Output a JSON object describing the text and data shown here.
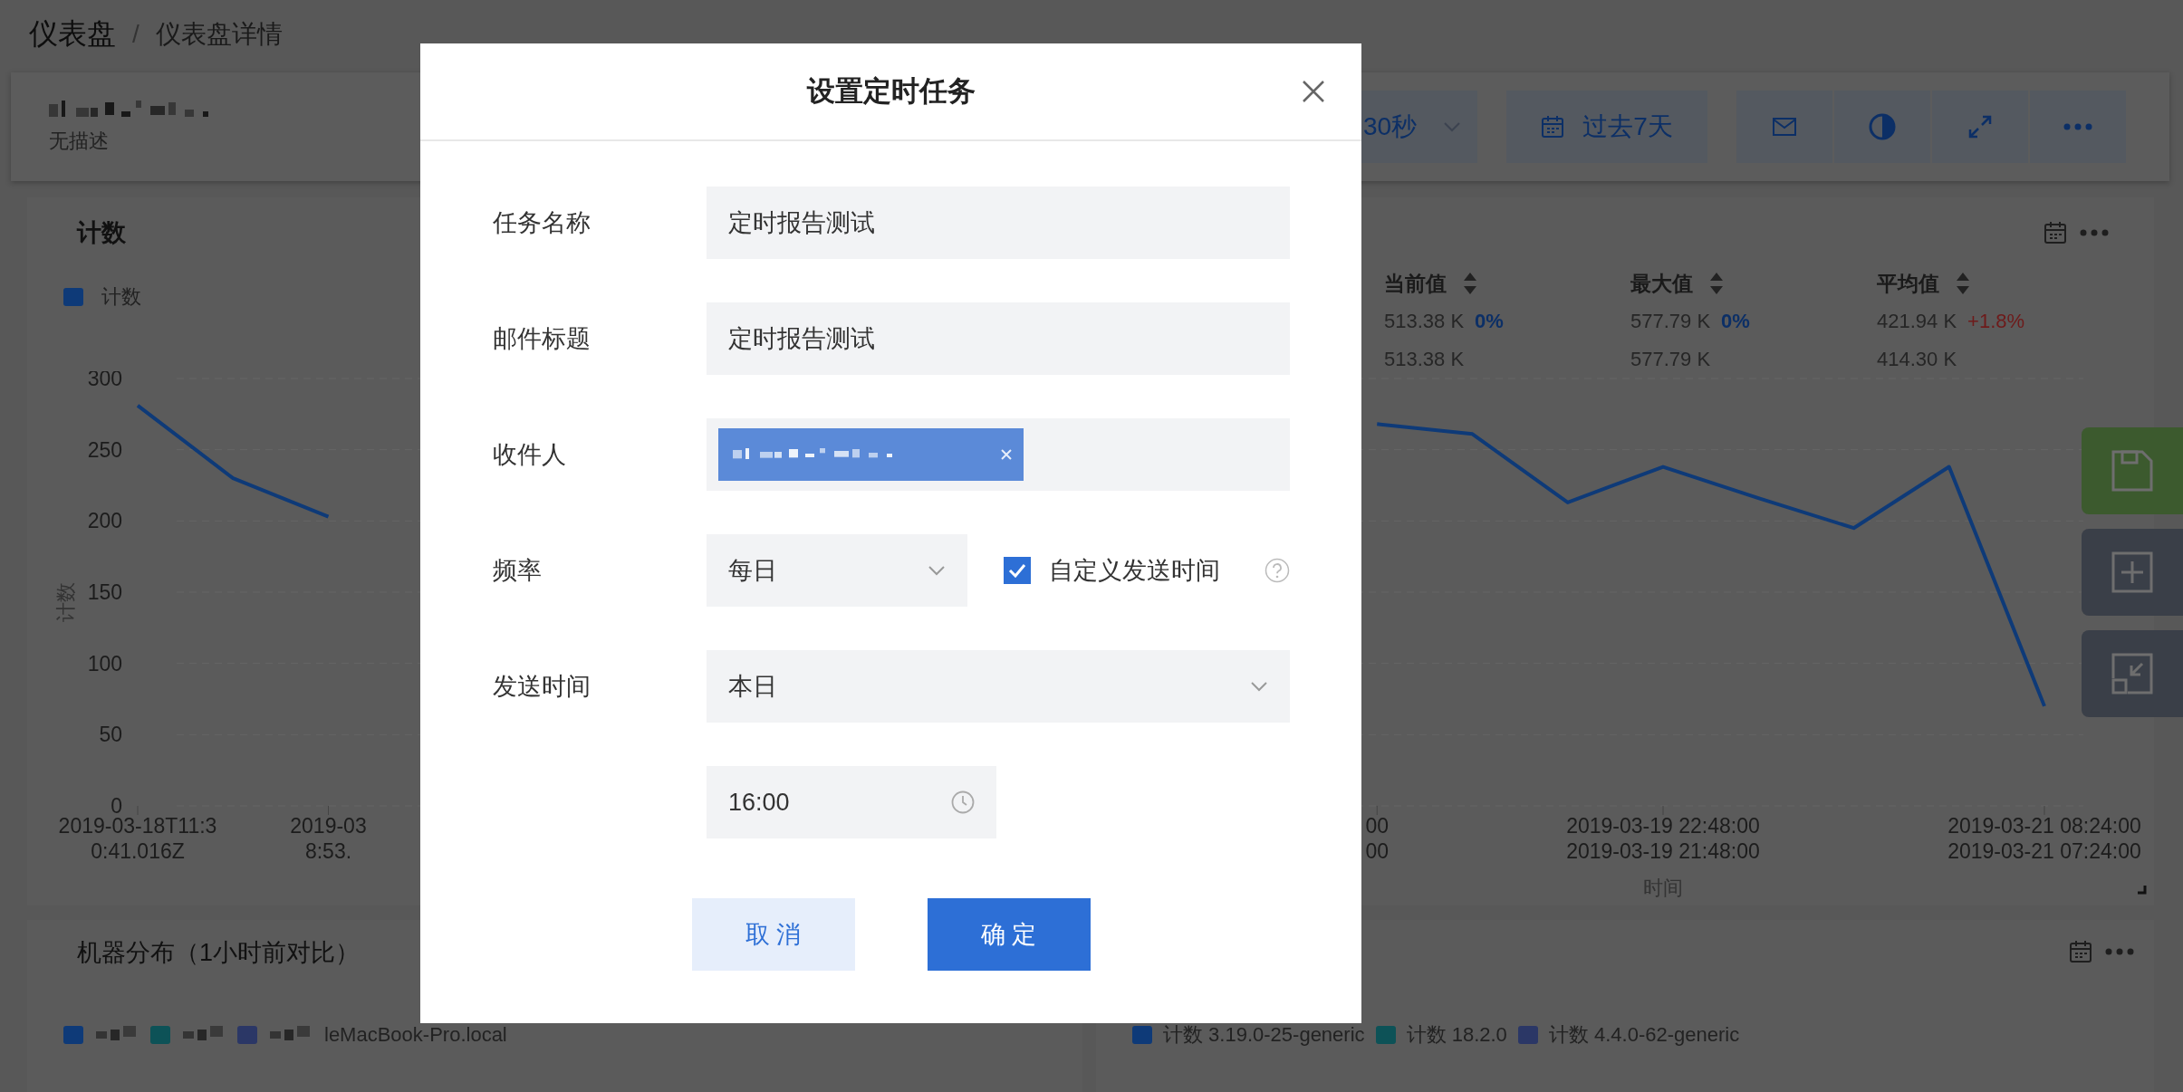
{
  "breadcrumb": {
    "items": [
      "仪表盘",
      "仪表盘详情"
    ],
    "separator": "/"
  },
  "dashboard": {
    "description": "无描述",
    "refresh": "30秒",
    "time_range": "过去7天"
  },
  "count_panel": {
    "title": "计数",
    "stats": {
      "columns": [
        "当前值",
        "最大值",
        "平均值"
      ],
      "rows": [
        [
          {
            "value": "513.38 K",
            "change": "0%",
            "rising": false
          },
          {
            "value": "577.79 K",
            "change": "0%",
            "rising": false
          },
          {
            "value": "421.94 K",
            "change": "+1.8%",
            "rising": true
          }
        ],
        [
          {
            "value": "513.38 K"
          },
          {
            "value": "577.79 K"
          },
          {
            "value": "414.30 K"
          }
        ]
      ]
    },
    "chart_data": {
      "type": "line",
      "ylabel": "计数",
      "xlabel": "时间",
      "categories": [
        "2019-03-18T11:3\n0:41.016Z",
        null,
        "2019-03\n8:53.",
        null,
        null,
        null,
        null,
        null,
        null,
        null,
        null,
        null,
        null,
        "00\n00",
        null,
        null,
        "2019-03-19 22:48:00\n2019-03-19 21:48:00",
        null,
        null,
        null,
        "2019-03-21 08:24:00\n2019-03-21 07:24:00"
      ],
      "ylim": [
        0,
        300
      ],
      "grid": true,
      "yticks": [
        0,
        50,
        100,
        150,
        200,
        250,
        300
      ],
      "series": [
        {
          "name": "计数",
          "color": "#0e3a78",
          "values": [
            281,
            230,
            203,
            null,
            null,
            null,
            null,
            null,
            null,
            null,
            null,
            null,
            null,
            268,
            261,
            213,
            238,
            216,
            195,
            238,
            70
          ]
        }
      ]
    }
  },
  "machine_panel": {
    "title": "机器分布（1小时前对比）",
    "legend": [
      {
        "color": "#0e3a78"
      },
      {
        "color": "#0d5257"
      },
      {
        "color": "#2b3766",
        "label": "leMacBook-Pro.local"
      }
    ]
  },
  "compare_panel": {
    "legend": [
      {
        "label": "计数 3.19.0-25-generic",
        "color": "#0e3a78"
      },
      {
        "label": "计数 18.2.0",
        "color": "#0d5257"
      },
      {
        "label": "计数 4.4.0-62-generic",
        "color": "#2b3766"
      }
    ]
  },
  "modal": {
    "title": "设置定时任务",
    "fields": [
      {
        "kind": "text",
        "label": "任务名称",
        "value": "定时报告测试"
      },
      {
        "kind": "text",
        "label": "邮件标题",
        "value": "定时报告测试"
      },
      {
        "kind": "tags",
        "label": "收件人",
        "tags": [
          {
            "kind": "redacted"
          }
        ]
      },
      {
        "kind": "select_check",
        "label": "频率",
        "value": "每日",
        "checkbox": {
          "label": "自定义发送时间",
          "checked": true
        }
      },
      {
        "kind": "select",
        "label": "发送时间",
        "value": "本日"
      },
      {
        "kind": "time",
        "value": "16:00"
      }
    ],
    "buttons": [
      {
        "label": "取 消",
        "kind": "secondary"
      },
      {
        "label": "确 定",
        "kind": "primary"
      }
    ]
  }
}
